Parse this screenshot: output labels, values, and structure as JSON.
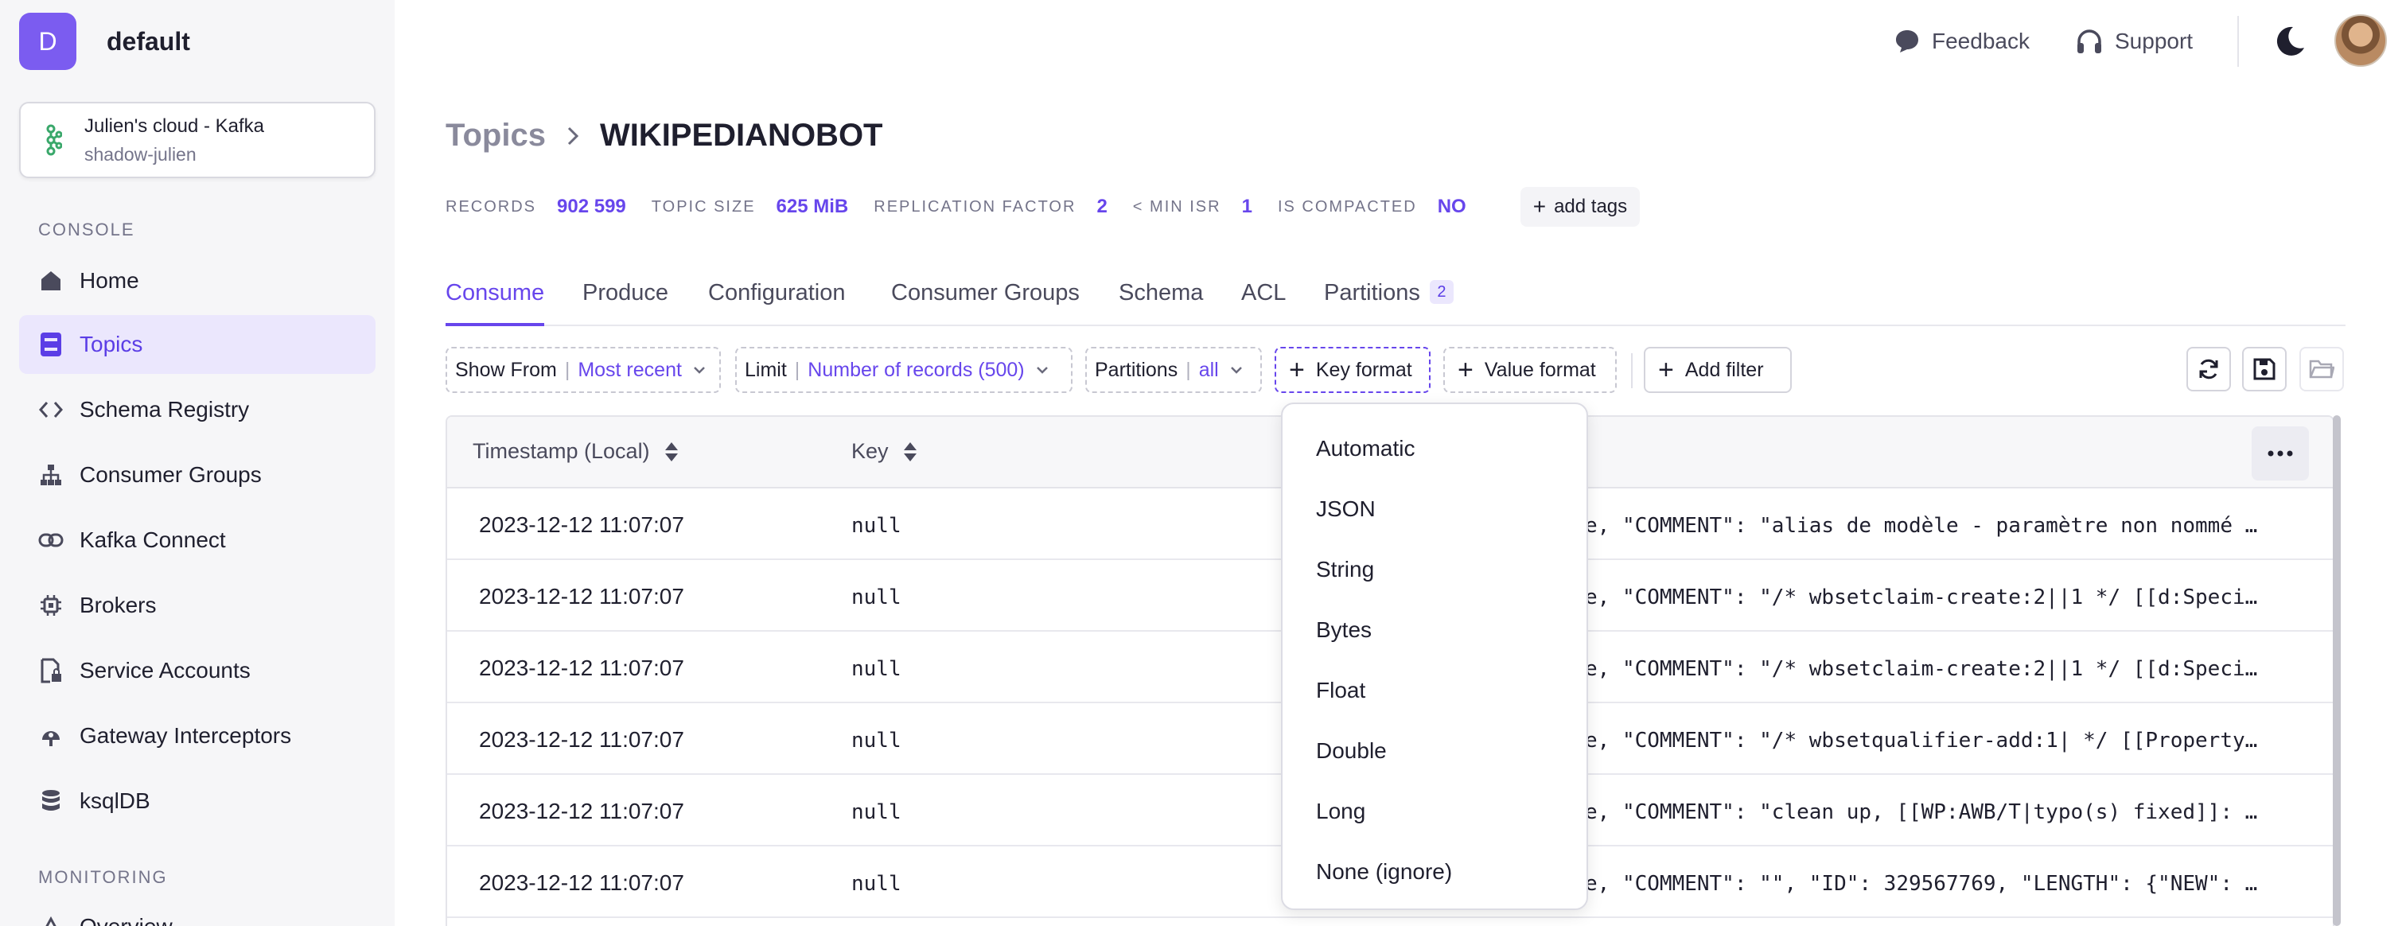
{
  "app": {
    "org_initial": "D",
    "org_name": "default",
    "accent": "#6746ec"
  },
  "cluster": {
    "name": "Julien's cloud - Kafka",
    "subtitle": "shadow-julien"
  },
  "sidebar": {
    "console_label": "CONSOLE",
    "monitoring_label": "MONITORING",
    "items": [
      {
        "label": "Home",
        "icon": "home-icon"
      },
      {
        "label": "Topics",
        "icon": "topics-icon",
        "active": true
      },
      {
        "label": "Schema Registry",
        "icon": "code-icon"
      },
      {
        "label": "Consumer Groups",
        "icon": "hierarchy-icon"
      },
      {
        "label": "Kafka Connect",
        "icon": "link-icon"
      },
      {
        "label": "Brokers",
        "icon": "chip-icon"
      },
      {
        "label": "Service Accounts",
        "icon": "document-lock-icon"
      },
      {
        "label": "Gateway Interceptors",
        "icon": "interceptor-icon"
      },
      {
        "label": "ksqlDB",
        "icon": "database-icon"
      }
    ],
    "monitoring_items": [
      {
        "label": "Overview",
        "icon": "overview-icon"
      }
    ]
  },
  "header": {
    "feedback": "Feedback",
    "support": "Support"
  },
  "breadcrumb": {
    "parent": "Topics",
    "current": "WIKIPEDIANOBOT"
  },
  "stats": {
    "records_label": "RECORDS",
    "records_value": "902 599",
    "size_label": "TOPIC SIZE",
    "size_value": "625 MiB",
    "replication_label": "REPLICATION FACTOR",
    "replication_value": "2",
    "isr_label": "< MIN ISR",
    "isr_value": "1",
    "compacted_label": "IS COMPACTED",
    "compacted_value": "NO",
    "add_tags": "add tags"
  },
  "tabs": {
    "consume": "Consume",
    "produce": "Produce",
    "configuration": "Configuration",
    "consumer_groups": "Consumer Groups",
    "schema": "Schema",
    "acl": "ACL",
    "partitions": "Partitions",
    "partitions_count": "2"
  },
  "filters": {
    "show_from_label": "Show From",
    "show_from_value": "Most recent",
    "limit_label": "Limit",
    "limit_value": "Number of records (500)",
    "partitions_label": "Partitions",
    "partitions_value": "all",
    "key_format": "Key format",
    "value_format": "Value format",
    "add_filter": "Add filter"
  },
  "table": {
    "col_timestamp": "Timestamp (Local)",
    "col_key": "Key",
    "rows": [
      {
        "timestamp": "2023-12-12 11:07:07",
        "key": "null",
        "value": "e, \"COMMENT\": \"alias de modèle - paramètre non nommé …"
      },
      {
        "timestamp": "2023-12-12 11:07:07",
        "key": "null",
        "value": "e, \"COMMENT\": \"/* wbsetclaim-create:2||1 */ [[d:Speci…"
      },
      {
        "timestamp": "2023-12-12 11:07:07",
        "key": "null",
        "value": "e, \"COMMENT\": \"/* wbsetclaim-create:2||1 */ [[d:Speci…"
      },
      {
        "timestamp": "2023-12-12 11:07:07",
        "key": "null",
        "value": "e, \"COMMENT\": \"/* wbsetqualifier-add:1| */ [[Property…"
      },
      {
        "timestamp": "2023-12-12 11:07:07",
        "key": "null",
        "value": "e, \"COMMENT\": \"clean up, [[WP:AWB/T|typo(s) fixed]]: …"
      },
      {
        "timestamp": "2023-12-12 11:07:07",
        "key": "null",
        "value": "e, \"COMMENT\": \"\", \"ID\": 329567769, \"LENGTH\": {\"NEW\": …"
      }
    ]
  },
  "key_format_menu": {
    "options": [
      "Automatic",
      "JSON",
      "String",
      "Bytes",
      "Float",
      "Double",
      "Long",
      "None (ignore)"
    ]
  }
}
